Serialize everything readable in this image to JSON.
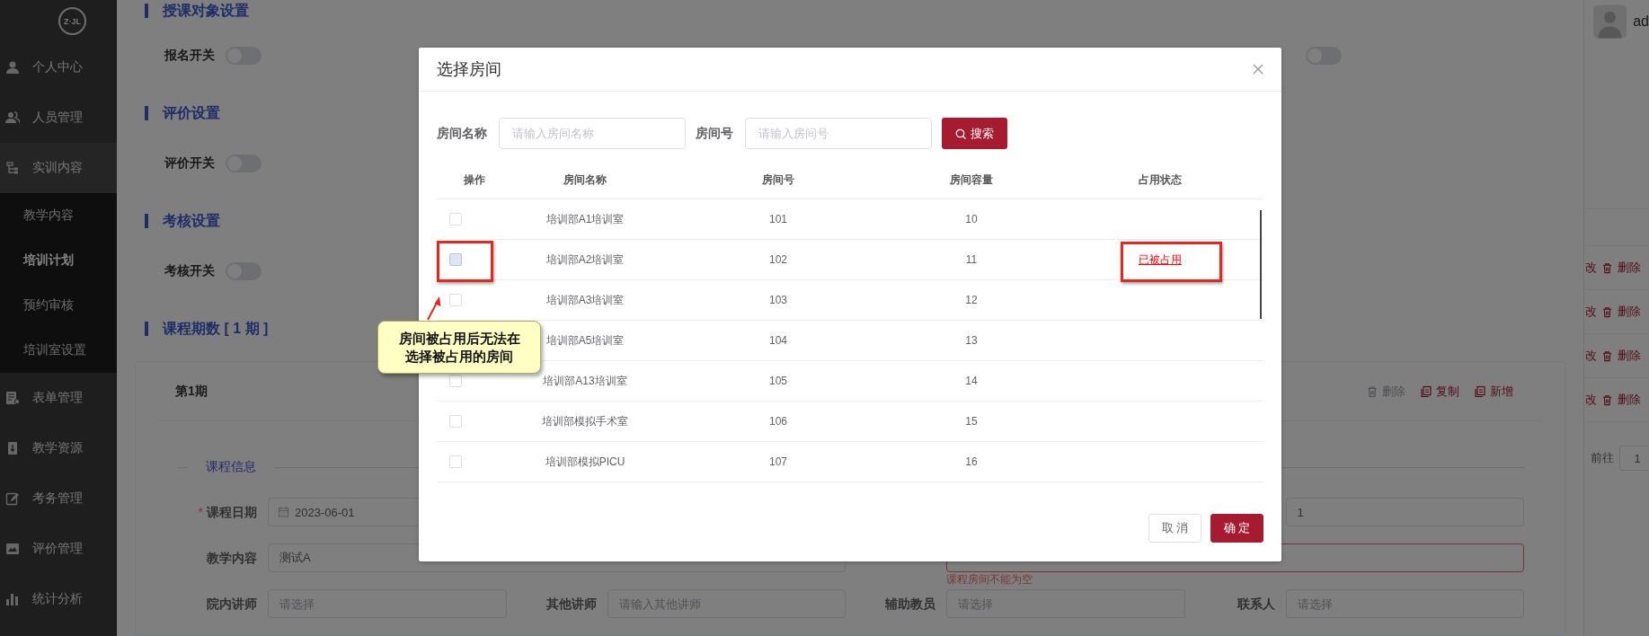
{
  "sidebar": {
    "logo": "Z·JL",
    "items": [
      {
        "label": "个人中心",
        "selected": false,
        "expanded": false
      },
      {
        "label": "人员管理",
        "selected": false,
        "expanded": false
      },
      {
        "label": "实训内容",
        "selected": false,
        "expanded": true,
        "children": [
          {
            "label": "教学内容",
            "selected": false
          },
          {
            "label": "培训计划",
            "selected": true
          },
          {
            "label": "预约审核",
            "selected": false
          },
          {
            "label": "培训室设置",
            "selected": false
          }
        ]
      },
      {
        "label": "表单管理",
        "selected": false,
        "expanded": false
      },
      {
        "label": "教学资源",
        "selected": false,
        "expanded": false
      },
      {
        "label": "考务管理",
        "selected": false,
        "expanded": false
      },
      {
        "label": "评价管理",
        "selected": false,
        "expanded": false
      },
      {
        "label": "统计分析",
        "selected": false,
        "expanded": false
      }
    ]
  },
  "main": {
    "sections": [
      {
        "title": "授课对象设置",
        "switches": [
          {
            "label": "报名开关",
            "on": false
          },
          {
            "on": false
          }
        ]
      },
      {
        "title": "评价设置",
        "switches": [
          {
            "label": "评价开关",
            "on": false
          }
        ]
      },
      {
        "title": "考核设置",
        "switches": [
          {
            "label": "考核开关",
            "on": false
          }
        ]
      }
    ],
    "periods": {
      "title": "课程期数 [ 1 期 ]",
      "card": {
        "title": "第1期",
        "actions": [
          {
            "label": "删除",
            "disabled": true
          },
          {
            "label": "复制",
            "disabled": false
          },
          {
            "label": "新增",
            "disabled": false
          }
        ],
        "legend": "课程信息",
        "rows": [
          [
            {
              "label": "课程日期",
              "required_mark": "*",
              "kind": "date",
              "value": "2023-06-01"
            },
            "",
            "",
            {
              "kind": "input",
              "value": "1"
            }
          ],
          [
            {
              "label": "教学内容",
              "kind": "input",
              "value": "测试A"
            },
            {
              "kind": "input",
              "error": "课程房间不能为空"
            }
          ],
          [
            {
              "label": "院内讲师",
              "kind": "input",
              "placeholder": "请选择"
            },
            {
              "label": "其他讲师",
              "kind": "input",
              "placeholder": "请输入其他讲师"
            },
            {
              "label": "辅助教员",
              "kind": "input",
              "placeholder": "请选择"
            },
            {
              "label": "联系人",
              "kind": "input",
              "placeholder": "请选择"
            }
          ]
        ]
      }
    }
  },
  "right_panel": {
    "user": "ad",
    "row_actions": [
      {
        "edit": "改",
        "delete": "删除"
      },
      {
        "edit": "改",
        "delete": "删除"
      },
      {
        "edit": "改",
        "delete": "删除"
      },
      {
        "edit": "改",
        "delete": "删除"
      }
    ],
    "pagination": {
      "label": "前往",
      "page": "1"
    }
  },
  "dialog": {
    "title": "选择房间",
    "search": {
      "fields": [
        {
          "label": "房间名称",
          "placeholder": "请输入房间名称"
        },
        {
          "label": "房间号",
          "placeholder": "请输入房间号"
        }
      ],
      "button": "搜索"
    },
    "table": {
      "columns": [
        "操作",
        "房间名称",
        "房间号",
        "房间容量",
        "占用状态"
      ],
      "rows": [
        {
          "checked": false,
          "disabled": false,
          "name": "培训部A1培训室",
          "number": "101",
          "capacity": "10"
        },
        {
          "checked": false,
          "disabled": true,
          "name": "培训部A2培训室",
          "number": "102",
          "capacity": "11",
          "status": "已被占用"
        },
        {
          "checked": false,
          "disabled": false,
          "name": "培训部A3培训室",
          "number": "103",
          "capacity": "12"
        },
        {
          "name": "培训部A5培训室",
          "number": "104",
          "capacity": "13"
        },
        {
          "checked": false,
          "disabled": false,
          "name": "培训部A13培训室",
          "number": "105",
          "capacity": "14"
        },
        {
          "checked": false,
          "disabled": false,
          "name": "培训部模拟手术室",
          "number": "106",
          "capacity": "15"
        },
        {
          "checked": false,
          "disabled": false,
          "name": "培训部模拟PICU",
          "number": "107",
          "capacity": "16"
        }
      ]
    },
    "buttons": [
      {
        "label": "取 消",
        "kind": "secondary"
      },
      {
        "label": "确 定",
        "kind": "primary"
      }
    ]
  },
  "annotation": {
    "text": "房间被占用后无法在选择被占用的房间"
  }
}
